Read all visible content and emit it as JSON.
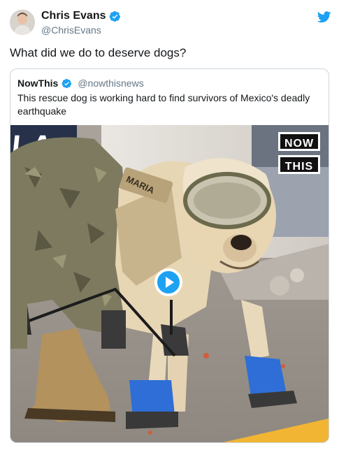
{
  "tweet": {
    "author": {
      "display_name": "Chris Evans",
      "handle": "@ChrisEvans",
      "verified": true
    },
    "text": "What did we do to deserve dogs?",
    "icons": {
      "verified": "verified-badge-icon",
      "brand": "twitter-bird-icon"
    },
    "colors": {
      "accent": "#1da1f2",
      "text": "#14171a",
      "muted": "#657786",
      "border": "#ccd6dd"
    }
  },
  "quoted_tweet": {
    "author": {
      "display_name": "NowThis",
      "handle": "@nowthisnews",
      "verified": true
    },
    "text": "This rescue dog is working hard to find survivors of Mexico's deadly earthquake",
    "media": {
      "type": "video",
      "watermark": {
        "line1": "NOW",
        "line2": "THIS"
      },
      "harness_label": "MARIA",
      "play_icon": "play-icon"
    }
  }
}
